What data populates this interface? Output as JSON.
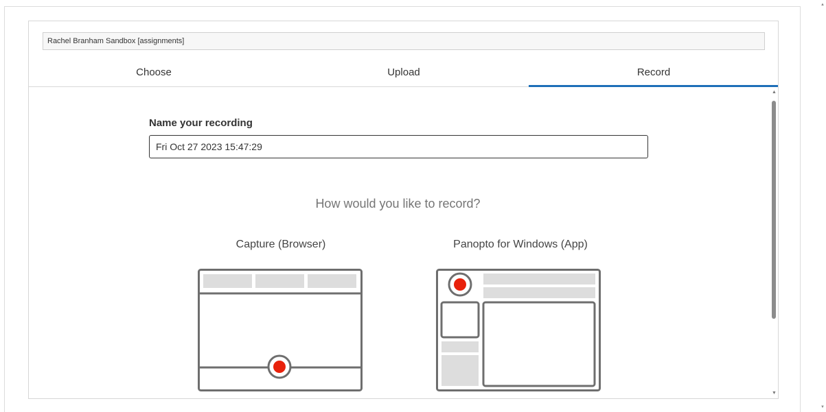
{
  "folder": {
    "name": "Rachel Branham Sandbox [assignments]"
  },
  "tabs": [
    {
      "label": "Choose",
      "active": false
    },
    {
      "label": "Upload",
      "active": false
    },
    {
      "label": "Record",
      "active": true
    }
  ],
  "recording": {
    "name_label": "Name your recording",
    "name_value": "Fri Oct 27 2023 15:47:29"
  },
  "record_prompt": "How would you like to record?",
  "options": [
    {
      "title": "Capture (Browser)",
      "icon": "browser-record-illustration"
    },
    {
      "title": "Panopto for Windows (App)",
      "icon": "app-record-illustration"
    }
  ],
  "colors": {
    "accent": "#1d6fb8",
    "record_red": "#e8210b",
    "illustration_stroke": "#6e6e6e",
    "illustration_fill": "#dddddd"
  }
}
